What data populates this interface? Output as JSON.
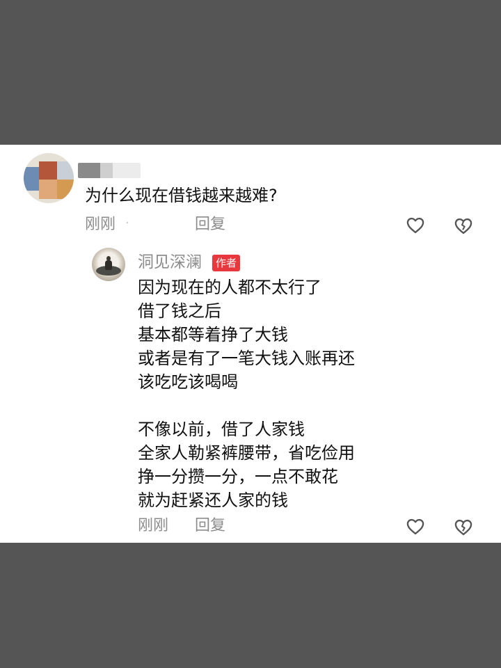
{
  "comment": {
    "text": "为什么现在借钱越来越难?",
    "time": "刚刚",
    "dot": "·",
    "reply_label": "回复",
    "like_icon": "heart-outline-icon",
    "dislike_icon": "broken-heart-icon"
  },
  "reply": {
    "author": "洞见深澜",
    "author_badge": "作者",
    "lines": [
      "因为现在的人都不太行了",
      "借了钱之后",
      "基本都等着挣了大钱",
      "或者是有了一笔大钱入账再还",
      "该吃吃该喝喝",
      "",
      "不像以前，借了人家钱",
      "全家人勒紧裤腰带，省吃俭用",
      "挣一分攒一分，一点不敢花",
      "就为赶紧还人家的钱"
    ],
    "time": "刚刚",
    "reply_label": "回复",
    "like_icon": "heart-outline-icon",
    "dislike_icon": "broken-heart-icon"
  },
  "colors": {
    "backdrop": "#555555",
    "card": "#ffffff",
    "text": "#111111",
    "meta": "#8c8c8c",
    "badge": "#e8383d"
  }
}
